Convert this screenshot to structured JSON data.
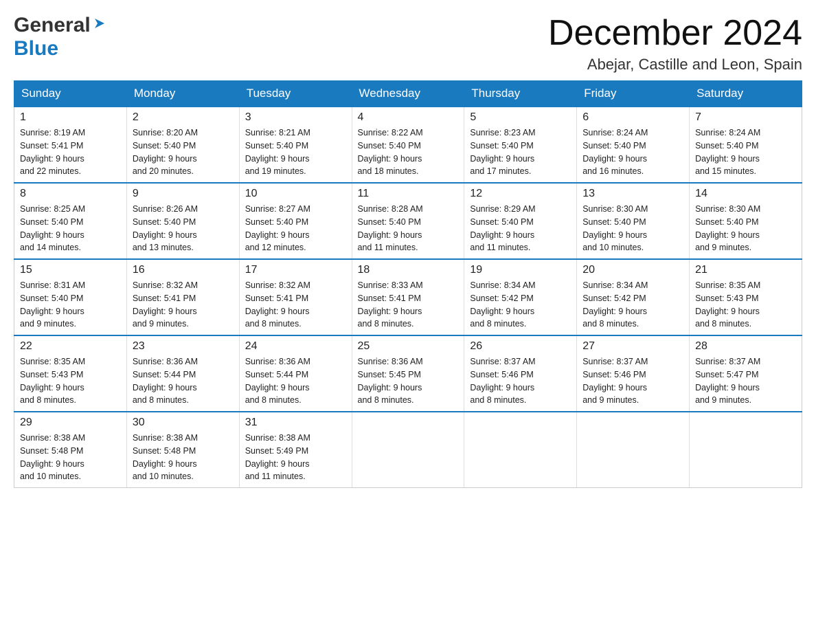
{
  "header": {
    "logo_general": "General",
    "logo_blue": "Blue",
    "month_title": "December 2024",
    "subtitle": "Abejar, Castille and Leon, Spain"
  },
  "days_of_week": [
    "Sunday",
    "Monday",
    "Tuesday",
    "Wednesday",
    "Thursday",
    "Friday",
    "Saturday"
  ],
  "weeks": [
    [
      {
        "day": "1",
        "sunrise": "8:19 AM",
        "sunset": "5:41 PM",
        "daylight": "9 hours and 22 minutes."
      },
      {
        "day": "2",
        "sunrise": "8:20 AM",
        "sunset": "5:40 PM",
        "daylight": "9 hours and 20 minutes."
      },
      {
        "day": "3",
        "sunrise": "8:21 AM",
        "sunset": "5:40 PM",
        "daylight": "9 hours and 19 minutes."
      },
      {
        "day": "4",
        "sunrise": "8:22 AM",
        "sunset": "5:40 PM",
        "daylight": "9 hours and 18 minutes."
      },
      {
        "day": "5",
        "sunrise": "8:23 AM",
        "sunset": "5:40 PM",
        "daylight": "9 hours and 17 minutes."
      },
      {
        "day": "6",
        "sunrise": "8:24 AM",
        "sunset": "5:40 PM",
        "daylight": "9 hours and 16 minutes."
      },
      {
        "day": "7",
        "sunrise": "8:24 AM",
        "sunset": "5:40 PM",
        "daylight": "9 hours and 15 minutes."
      }
    ],
    [
      {
        "day": "8",
        "sunrise": "8:25 AM",
        "sunset": "5:40 PM",
        "daylight": "9 hours and 14 minutes."
      },
      {
        "day": "9",
        "sunrise": "8:26 AM",
        "sunset": "5:40 PM",
        "daylight": "9 hours and 13 minutes."
      },
      {
        "day": "10",
        "sunrise": "8:27 AM",
        "sunset": "5:40 PM",
        "daylight": "9 hours and 12 minutes."
      },
      {
        "day": "11",
        "sunrise": "8:28 AM",
        "sunset": "5:40 PM",
        "daylight": "9 hours and 11 minutes."
      },
      {
        "day": "12",
        "sunrise": "8:29 AM",
        "sunset": "5:40 PM",
        "daylight": "9 hours and 11 minutes."
      },
      {
        "day": "13",
        "sunrise": "8:30 AM",
        "sunset": "5:40 PM",
        "daylight": "9 hours and 10 minutes."
      },
      {
        "day": "14",
        "sunrise": "8:30 AM",
        "sunset": "5:40 PM",
        "daylight": "9 hours and 9 minutes."
      }
    ],
    [
      {
        "day": "15",
        "sunrise": "8:31 AM",
        "sunset": "5:40 PM",
        "daylight": "9 hours and 9 minutes."
      },
      {
        "day": "16",
        "sunrise": "8:32 AM",
        "sunset": "5:41 PM",
        "daylight": "9 hours and 9 minutes."
      },
      {
        "day": "17",
        "sunrise": "8:32 AM",
        "sunset": "5:41 PM",
        "daylight": "9 hours and 8 minutes."
      },
      {
        "day": "18",
        "sunrise": "8:33 AM",
        "sunset": "5:41 PM",
        "daylight": "9 hours and 8 minutes."
      },
      {
        "day": "19",
        "sunrise": "8:34 AM",
        "sunset": "5:42 PM",
        "daylight": "9 hours and 8 minutes."
      },
      {
        "day": "20",
        "sunrise": "8:34 AM",
        "sunset": "5:42 PM",
        "daylight": "9 hours and 8 minutes."
      },
      {
        "day": "21",
        "sunrise": "8:35 AM",
        "sunset": "5:43 PM",
        "daylight": "9 hours and 8 minutes."
      }
    ],
    [
      {
        "day": "22",
        "sunrise": "8:35 AM",
        "sunset": "5:43 PM",
        "daylight": "9 hours and 8 minutes."
      },
      {
        "day": "23",
        "sunrise": "8:36 AM",
        "sunset": "5:44 PM",
        "daylight": "9 hours and 8 minutes."
      },
      {
        "day": "24",
        "sunrise": "8:36 AM",
        "sunset": "5:44 PM",
        "daylight": "9 hours and 8 minutes."
      },
      {
        "day": "25",
        "sunrise": "8:36 AM",
        "sunset": "5:45 PM",
        "daylight": "9 hours and 8 minutes."
      },
      {
        "day": "26",
        "sunrise": "8:37 AM",
        "sunset": "5:46 PM",
        "daylight": "9 hours and 8 minutes."
      },
      {
        "day": "27",
        "sunrise": "8:37 AM",
        "sunset": "5:46 PM",
        "daylight": "9 hours and 9 minutes."
      },
      {
        "day": "28",
        "sunrise": "8:37 AM",
        "sunset": "5:47 PM",
        "daylight": "9 hours and 9 minutes."
      }
    ],
    [
      {
        "day": "29",
        "sunrise": "8:38 AM",
        "sunset": "5:48 PM",
        "daylight": "9 hours and 10 minutes."
      },
      {
        "day": "30",
        "sunrise": "8:38 AM",
        "sunset": "5:48 PM",
        "daylight": "9 hours and 10 minutes."
      },
      {
        "day": "31",
        "sunrise": "8:38 AM",
        "sunset": "5:49 PM",
        "daylight": "9 hours and 11 minutes."
      },
      null,
      null,
      null,
      null
    ]
  ],
  "labels": {
    "sunrise": "Sunrise:",
    "sunset": "Sunset:",
    "daylight": "Daylight:"
  }
}
